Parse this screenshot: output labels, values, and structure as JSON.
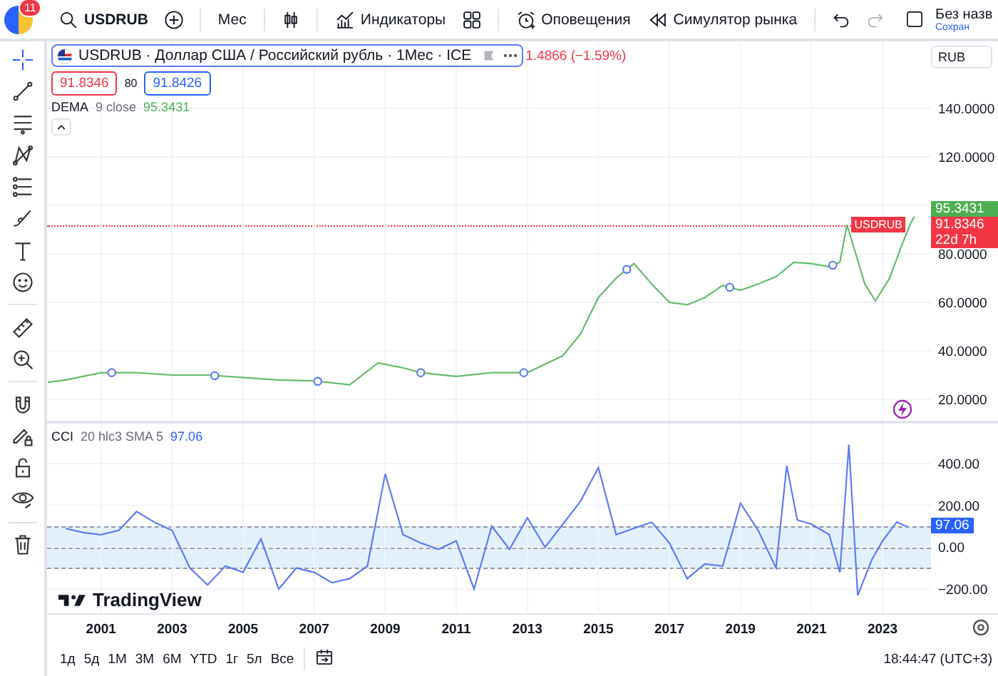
{
  "header": {
    "avatar_badge": "11",
    "symbol": "USDRUB",
    "interval": "Мес",
    "tools": [
      {
        "kind": "add"
      },
      {
        "kind": "interval"
      },
      {
        "kind": "candles"
      },
      {
        "kind": "indicators",
        "label": "Индикаторы"
      },
      {
        "kind": "layouts"
      },
      {
        "kind": "alerts",
        "label": "Оповещения"
      },
      {
        "kind": "replay",
        "label": "Симулятор рынка"
      },
      {
        "kind": "undo",
        "disabled": false
      },
      {
        "kind": "redo",
        "disabled": true
      }
    ],
    "layout_title": "Без назв",
    "layout_status": "Сохран"
  },
  "drawing_tools": [
    {
      "kind": "crosshair",
      "selected": true
    },
    {
      "kind": "trend-line",
      "selected": false
    },
    {
      "kind": "horizontal-lines",
      "selected": false
    },
    {
      "kind": "pattern",
      "selected": false
    },
    {
      "kind": "fib",
      "selected": false
    },
    {
      "kind": "brush",
      "selected": false
    },
    {
      "kind": "text",
      "selected": false
    },
    {
      "kind": "smiley",
      "selected": false
    },
    {
      "kind": "ruler",
      "selected": false
    },
    {
      "kind": "zoom-in",
      "selected": false
    },
    {
      "kind": "magnet",
      "selected": false
    },
    {
      "kind": "pencil-lock",
      "selected": false
    },
    {
      "kind": "lock",
      "selected": false
    },
    {
      "kind": "eye",
      "selected": false
    },
    {
      "kind": "trash",
      "selected": false
    }
  ],
  "legend": {
    "title": "USDRUB · Доллар США / Российский рубль · 1Мес · ICE",
    "change": "1.4866 (−1.59%)",
    "sell": "91.8346",
    "spread": "80",
    "buy": "91.8426"
  },
  "indicators": [
    {
      "name": "DEMA",
      "params": "9 close",
      "value": "95.3431",
      "color": "#4caf50"
    },
    {
      "name": "CCI",
      "params": "20 hlc3 SMA 5",
      "value": "97.06",
      "color": "#2962ff"
    }
  ],
  "currency": "RUB",
  "price_pane": {
    "last_value_tag": "95.3431",
    "price_tag": "91.8346",
    "countdown": "22d 7h",
    "symbol_tag": "USDRUB",
    "chart_data": {
      "type": "line",
      "x": [
        1999.5,
        2000,
        2001,
        2002,
        2003,
        2004,
        2005,
        2006,
        2007,
        2008,
        2008.8,
        2009.5,
        2010,
        2011,
        2012,
        2013,
        2014,
        2014.5,
        2015,
        2015.5,
        2016,
        2016.5,
        2017,
        2017.5,
        2018,
        2018.5,
        2019,
        2019.5,
        2020,
        2020.5,
        2021,
        2021.5,
        2021.8,
        2022,
        2022.5,
        2022.8,
        2023.2,
        2023.5,
        2023.8,
        2023.9
      ],
      "series": [
        {
          "color": "#66bb6a",
          "values": [
            27,
            28,
            31,
            31,
            30,
            30,
            29,
            28,
            27.6,
            26,
            35,
            33,
            31,
            29.5,
            31,
            31,
            38,
            47,
            62,
            70,
            76,
            67.6,
            60,
            59,
            62,
            67,
            65,
            67.6,
            70.6,
            76.5,
            76,
            74.7,
            76.5,
            92,
            67.6,
            60.6,
            70,
            82,
            93,
            95.3
          ]
        }
      ],
      "xlim": [
        1999.48,
        2026.25
      ],
      "ylim": [
        11.2,
        167.6
      ],
      "grid": true,
      "yticks": [
        {
          "value": 20,
          "label": "20.0000"
        },
        {
          "value": 40,
          "label": "40.0000"
        },
        {
          "value": 60,
          "label": "60.0000"
        },
        {
          "value": 80,
          "label": "80.0000"
        },
        {
          "value": 120,
          "label": "120.0000"
        },
        {
          "value": 140,
          "label": "140.0000"
        }
      ]
    }
  },
  "cci_pane": {
    "value_tag": "97.06",
    "chart_data": {
      "type": "line",
      "x": [
        2000,
        2000.5,
        2001,
        2001.5,
        2002,
        2002.5,
        2003,
        2003.5,
        2004,
        2004.5,
        2005,
        2005.5,
        2006,
        2006.5,
        2007,
        2007.5,
        2008,
        2008.5,
        2009,
        2009.5,
        2010,
        2010.5,
        2011,
        2011.5,
        2012,
        2012.5,
        2013,
        2013.5,
        2014,
        2014.5,
        2015,
        2015.5,
        2016,
        2016.5,
        2017,
        2017.5,
        2018,
        2018.5,
        2019,
        2019.5,
        2020,
        2020.3,
        2020.6,
        2021,
        2021.5,
        2021.8,
        2022.05,
        2022.3,
        2022.7,
        2023,
        2023.4,
        2023.7
      ],
      "series": [
        {
          "color": "#5b7cf7",
          "values": [
            90,
            70,
            60,
            80,
            170,
            120,
            80,
            -100,
            -180,
            -90,
            -120,
            40,
            -200,
            -100,
            -120,
            -170,
            -150,
            -90,
            350,
            60,
            20,
            -10,
            30,
            -200,
            100,
            -10,
            140,
            0,
            110,
            220,
            380,
            60,
            90,
            120,
            20,
            -150,
            -80,
            -90,
            210,
            80,
            -100,
            390,
            130,
            110,
            60,
            -120,
            490,
            -230,
            -60,
            30,
            120,
            97
          ]
        }
      ],
      "xlim": [
        1999.48,
        2026.25
      ],
      "ylim": [
        -315.9,
        590.9
      ],
      "grid": true,
      "xticks": [
        2001,
        2003,
        2005,
        2007,
        2009,
        2011,
        2013,
        2015,
        2017,
        2019,
        2021,
        2023
      ],
      "yticks": [
        {
          "value": 400,
          "label": "400.00"
        },
        {
          "value": 200,
          "label": "200.00"
        },
        {
          "value": 0,
          "label": "0.00"
        },
        {
          "value": -200,
          "label": "−200.00"
        }
      ]
    }
  },
  "brand": "TradingView",
  "ranges": [
    "1д",
    "5д",
    "1M",
    "3M",
    "6M",
    "YTD",
    "1г",
    "5л",
    "Все"
  ],
  "clock": "18:44:47 (UTC+3)"
}
